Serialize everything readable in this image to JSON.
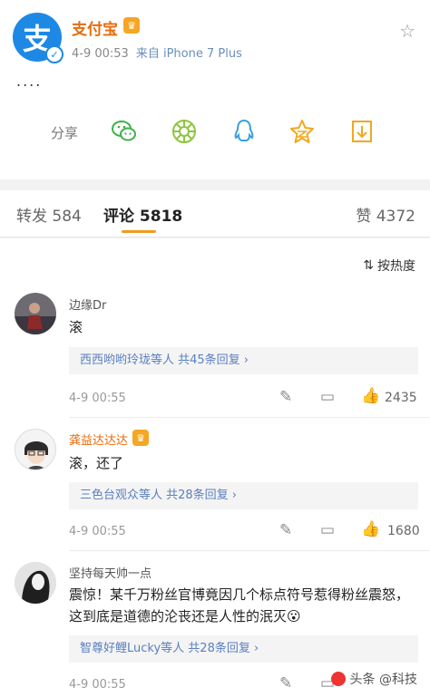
{
  "post": {
    "author": "支付宝",
    "time": "4-9 00:53",
    "source": "来自 iPhone 7 Plus",
    "text": "....",
    "share_label": "分享",
    "share_targets": [
      "wechat-icon",
      "moments-icon",
      "qq-icon",
      "qzone-icon",
      "save-icon"
    ]
  },
  "tabs": {
    "repost": "转发 584",
    "comments": "评论 5818",
    "likes": "赞 4372"
  },
  "sort_label": "按热度",
  "comments": [
    {
      "name": "边缘Dr",
      "text": "滚",
      "replies": "西西哟哟玲珑等人 共45条回复 ›",
      "time": "4-9 00:55",
      "likes": "2435"
    },
    {
      "name": "龚益达达达",
      "text": "滚，还了",
      "replies": "三色台观众等人 共28条回复 ›",
      "time": "4-9 00:55",
      "likes": "1680"
    },
    {
      "name": "坚持每天帅一点",
      "text": "震惊！某千万粉丝官博竟因几个标点符号惹得粉丝震怒，这到底是道德的沦丧还是人性的泯灭😮",
      "replies": "智尊好鲤Lucky等人 共28条回复 ›",
      "time": "4-9 00:55",
      "likes": ""
    }
  ],
  "watermark": "头条 @科技"
}
